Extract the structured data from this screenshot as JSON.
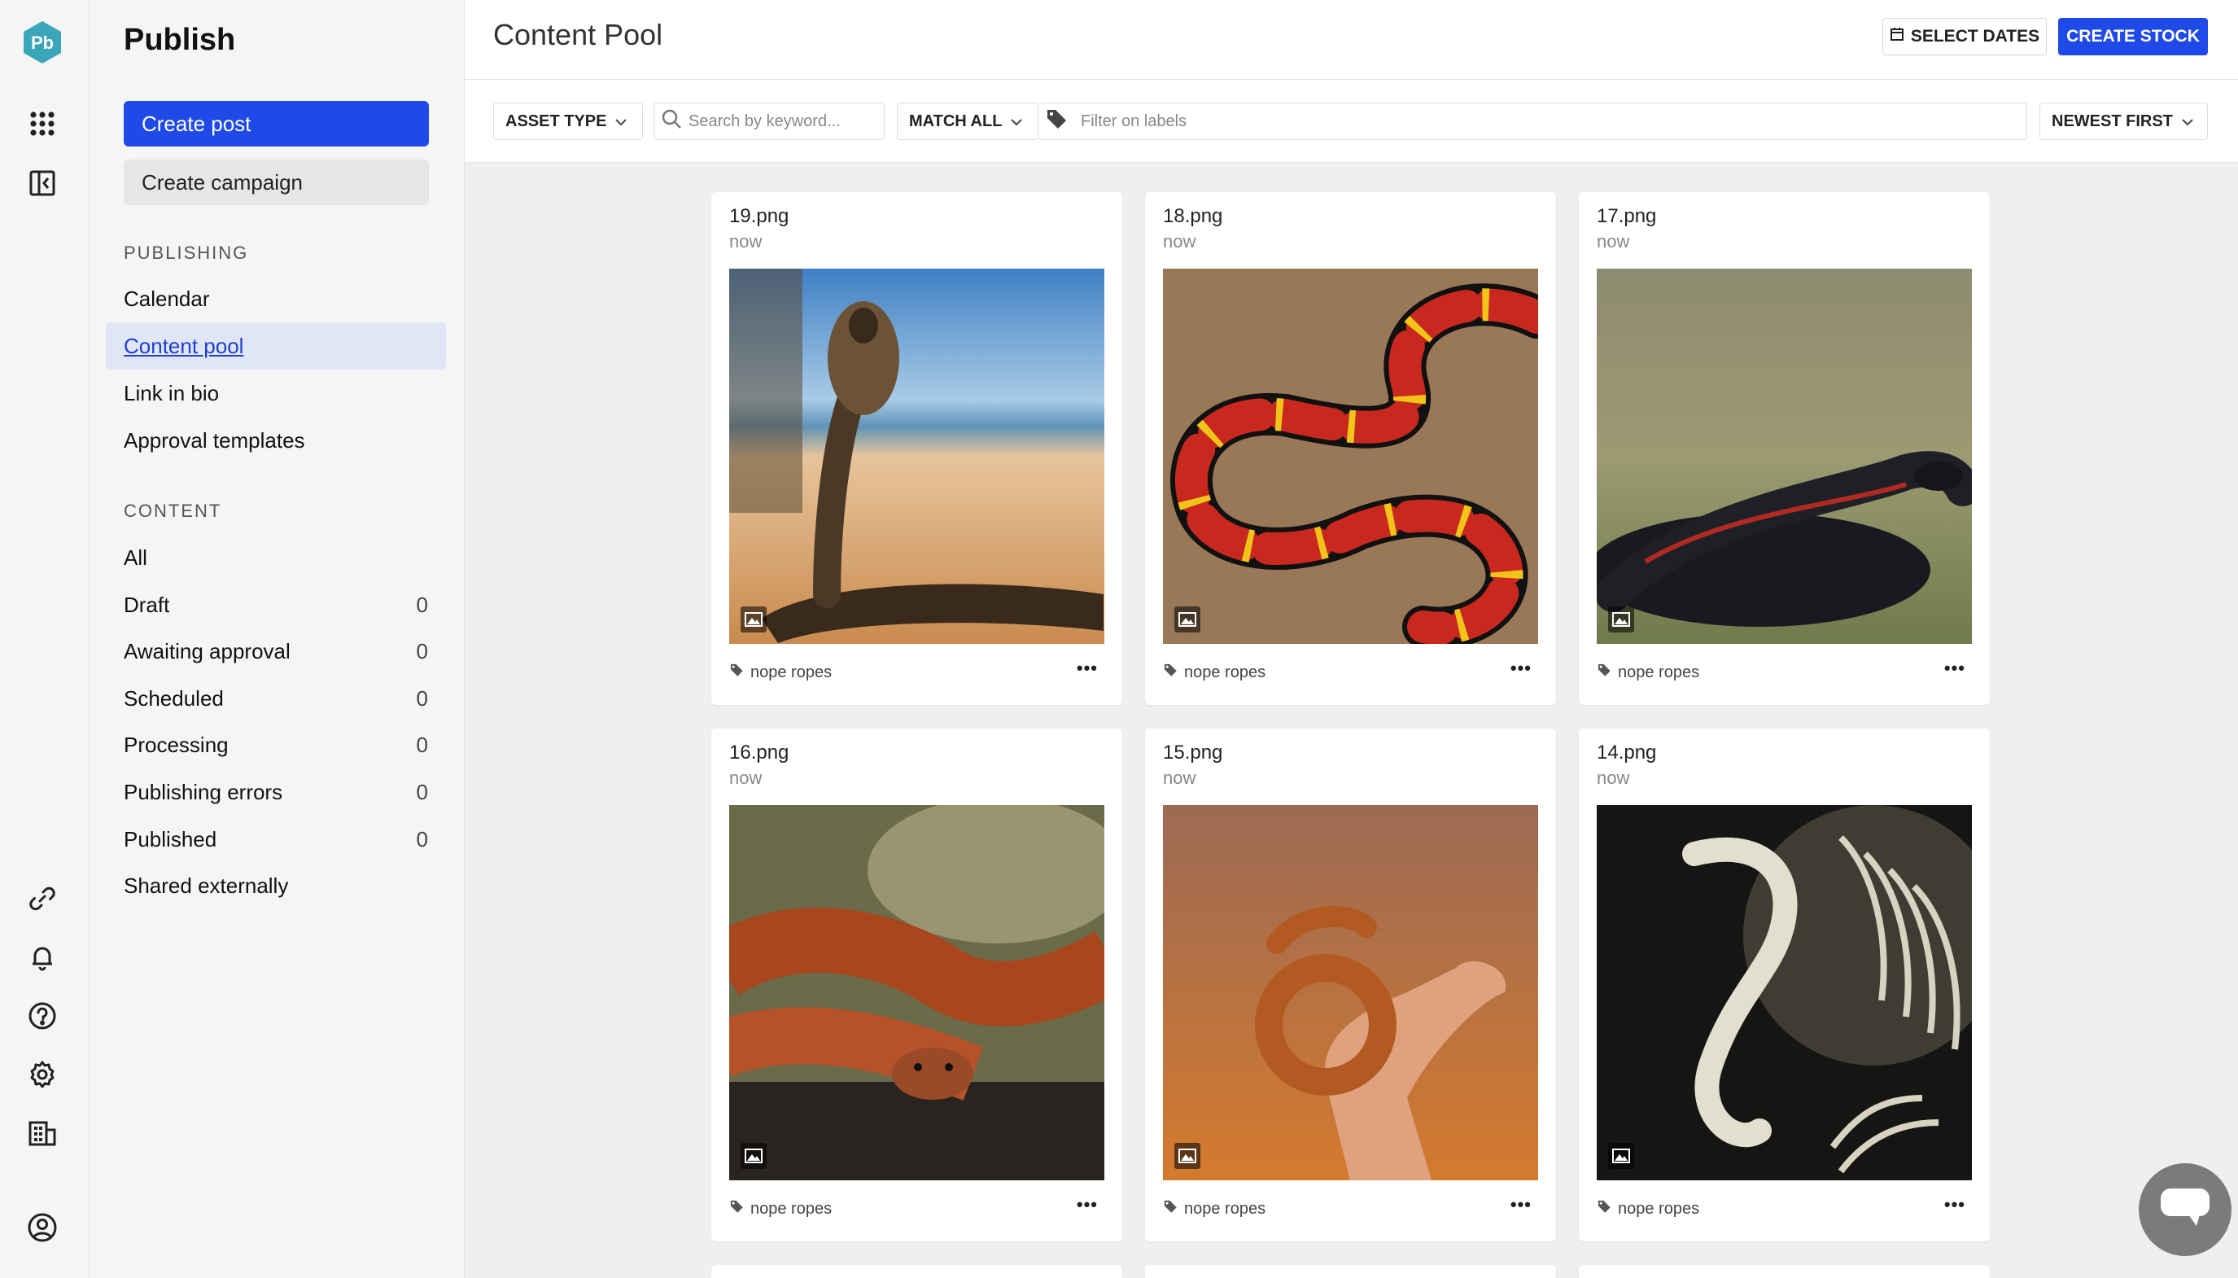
{
  "app": {
    "logo_text": "Pb",
    "title": "Publish"
  },
  "sidebar": {
    "create_post": "Create post",
    "create_campaign": "Create campaign",
    "publishing_header": "PUBLISHING",
    "publishing_items": [
      {
        "label": "Calendar"
      },
      {
        "label": "Content pool"
      },
      {
        "label": "Link in bio"
      },
      {
        "label": "Approval templates"
      }
    ],
    "content_header": "CONTENT",
    "content_items": [
      {
        "label": "All",
        "count": ""
      },
      {
        "label": "Draft",
        "count": "0"
      },
      {
        "label": "Awaiting approval",
        "count": "0"
      },
      {
        "label": "Scheduled",
        "count": "0"
      },
      {
        "label": "Processing",
        "count": "0"
      },
      {
        "label": "Publishing errors",
        "count": "0"
      },
      {
        "label": "Published",
        "count": "0"
      },
      {
        "label": "Shared externally",
        "count": ""
      }
    ]
  },
  "header": {
    "title": "Content Pool",
    "select_dates": "SELECT DATES",
    "create_stock": "CREATE STOCK"
  },
  "filters": {
    "asset_type": "ASSET TYPE",
    "search_placeholder": "Search by keyword...",
    "match": "MATCH ALL",
    "labels_placeholder": "Filter on labels",
    "sort": "NEWEST FIRST"
  },
  "cards": [
    {
      "name": "19.png",
      "time": "now",
      "label": "nope ropes",
      "more": "•••"
    },
    {
      "name": "18.png",
      "time": "now",
      "label": "nope ropes",
      "more": "•••"
    },
    {
      "name": "17.png",
      "time": "now",
      "label": "nope ropes",
      "more": "•••"
    },
    {
      "name": "16.png",
      "time": "now",
      "label": "nope ropes",
      "more": "•••"
    },
    {
      "name": "15.png",
      "time": "now",
      "label": "nope ropes",
      "more": "•••"
    },
    {
      "name": "14.png",
      "time": "now",
      "label": "nope ropes",
      "more": "•••"
    }
  ],
  "colors": {
    "accent": "#1f4ae8",
    "active_bg": "#e1e6f7",
    "logo": "#3aa6b9"
  }
}
